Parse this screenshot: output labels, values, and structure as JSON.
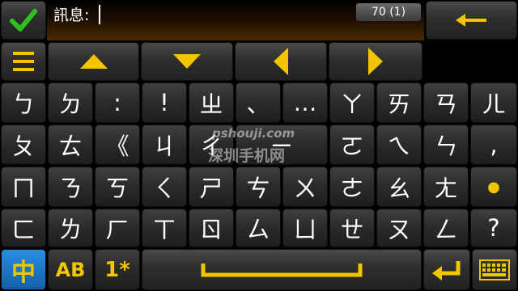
{
  "header": {
    "message_label": "訊息:",
    "char_counter": "70 (1)"
  },
  "icons": {
    "confirm": "checkmark-icon",
    "backspace": "arrow-left-icon",
    "menu": "menu-icon",
    "up": "arrow-up-icon",
    "down": "arrow-down-icon",
    "left": "arrow-left-icon",
    "right": "arrow-right-icon",
    "space": "space-bar-icon",
    "enter": "enter-icon",
    "keyboard": "keyboard-icon"
  },
  "keys": {
    "row1": [
      "ㄅ",
      "ㄉ",
      ":",
      "!",
      "ㄓ",
      "、",
      "…",
      "ㄚ",
      "ㄞ",
      "ㄢ",
      "ㄦ"
    ],
    "row2": [
      "ㄆ",
      "ㄊ",
      "《",
      "ㄐ",
      "ㄔ",
      "ㄧ",
      "ㄛ",
      "ㄟ",
      "ㄣ",
      ","
    ],
    "row3": [
      "ㄇ",
      "ㄋ",
      "ㄎ",
      "ㄑ",
      "ㄕ",
      "ㄘ",
      "ㄨ",
      "ㄜ",
      "ㄠ",
      "ㄤ",
      "●"
    ],
    "row4": [
      "ㄈ",
      "ㄌ",
      "ㄏ",
      "ㄒ",
      "ㄖ",
      "ㄙ",
      "ㄩ",
      "ㄝ",
      "ㄡ",
      "ㄥ",
      "?"
    ]
  },
  "bottom": {
    "mode_chinese": "中",
    "mode_alpha": "AB",
    "mode_numeric": "1*"
  },
  "watermark": {
    "url": "pshouji.com",
    "site": "深圳手机网"
  },
  "colors": {
    "accent": "#f2c500",
    "active_mode": "#1a7fd0",
    "confirm_green": "#2ec21f"
  }
}
